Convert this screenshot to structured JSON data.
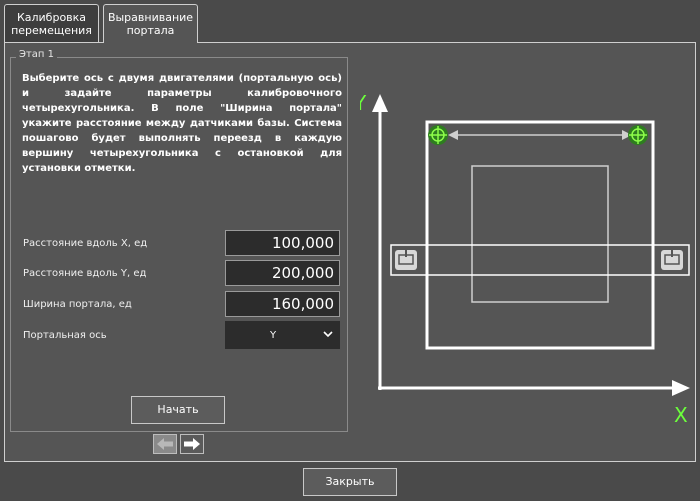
{
  "tabs": {
    "calibration": "Калибровка перемещения",
    "portal": "Выравнивание портала"
  },
  "stage": {
    "title": "Этап 1",
    "description": "Выберите ось с двумя двигателями (портальную ось) и задайте параметры калибровочного четырехугольника. В поле \"Ширина портала\" укажите расстояние между датчиками базы. Система пошагово будет выполнять переезд в каждую вершину четырехугольника с остановкой для установки отметки."
  },
  "fields": {
    "dist_x": {
      "label": "Расстояние вдоль X, ед",
      "value": "100,000"
    },
    "dist_y": {
      "label": "Расстояние вдоль Y, ед",
      "value": "200,000"
    },
    "portal_width": {
      "label": "Ширина портала, ед",
      "value": "160,000"
    },
    "portal_axis": {
      "label": "Портальная ось",
      "value": "Y"
    }
  },
  "buttons": {
    "start": "Начать",
    "close": "Закрыть"
  },
  "diagram": {
    "axis_x": "X",
    "axis_y": "Y",
    "axis_color": "#ffffff",
    "label_green": "#6cff3c"
  },
  "icons": {
    "prev": "arrow-left-icon",
    "next": "arrow-right-icon",
    "sensor": "crosshair-icon",
    "motor": "motor-icon",
    "dropdown": "chevron-down-icon"
  }
}
